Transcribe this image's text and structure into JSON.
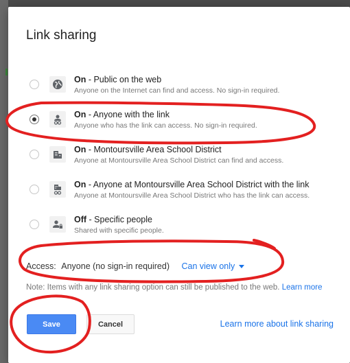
{
  "dialog": {
    "title": "Link sharing",
    "options": [
      {
        "bold": "On",
        "rest": " - Public on the web",
        "desc": "Anyone on the Internet can find and access. No sign-in required.",
        "icon": "globe-icon",
        "selected": false
      },
      {
        "bold": "On",
        "rest": " - Anyone with the link",
        "desc": "Anyone who has the link can access. No sign-in required.",
        "icon": "person-link-icon",
        "selected": true
      },
      {
        "bold": "On",
        "rest": " - Montoursville Area School District",
        "desc": "Anyone at Montoursville Area School District can find and access.",
        "icon": "building-icon",
        "selected": false
      },
      {
        "bold": "On",
        "rest": " - Anyone at Montoursville Area School District with the link",
        "desc": "Anyone at Montoursville Area School District who has the link can access.",
        "icon": "building-link-icon",
        "selected": false
      },
      {
        "bold": "Off",
        "rest": " - Specific people",
        "desc": "Shared with specific people.",
        "icon": "person-lock-icon",
        "selected": false
      }
    ],
    "access": {
      "label": "Access:",
      "value": "Anyone (no sign-in required)",
      "permission": "Can view only"
    },
    "note": {
      "text": "Note: Items with any link sharing option can still be published to the web.",
      "link": "Learn more"
    },
    "buttons": {
      "save": "Save",
      "cancel": "Cancel"
    },
    "learn_more_sharing": "Learn more about link sharing"
  },
  "colors": {
    "accent": "#1a73e8",
    "save_button": "#4a8af4",
    "annotation": "#e32020"
  }
}
